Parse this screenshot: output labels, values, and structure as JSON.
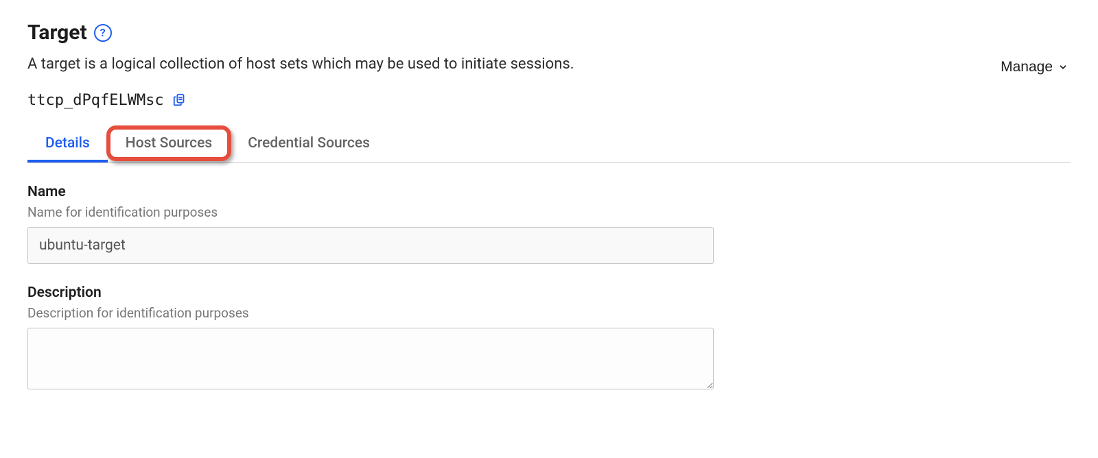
{
  "header": {
    "title": "Target",
    "description": "A target is a logical collection of host sets which may be used to initiate sessions.",
    "target_id": "ttcp_dPqfELWMsc",
    "manage_label": "Manage"
  },
  "tabs": [
    {
      "label": "Details",
      "active": true,
      "highlighted": false
    },
    {
      "label": "Host Sources",
      "active": false,
      "highlighted": true
    },
    {
      "label": "Credential Sources",
      "active": false,
      "highlighted": false
    }
  ],
  "form": {
    "name": {
      "label": "Name",
      "hint": "Name for identification purposes",
      "value": "ubuntu-target"
    },
    "description": {
      "label": "Description",
      "hint": "Description for identification purposes",
      "value": ""
    }
  }
}
